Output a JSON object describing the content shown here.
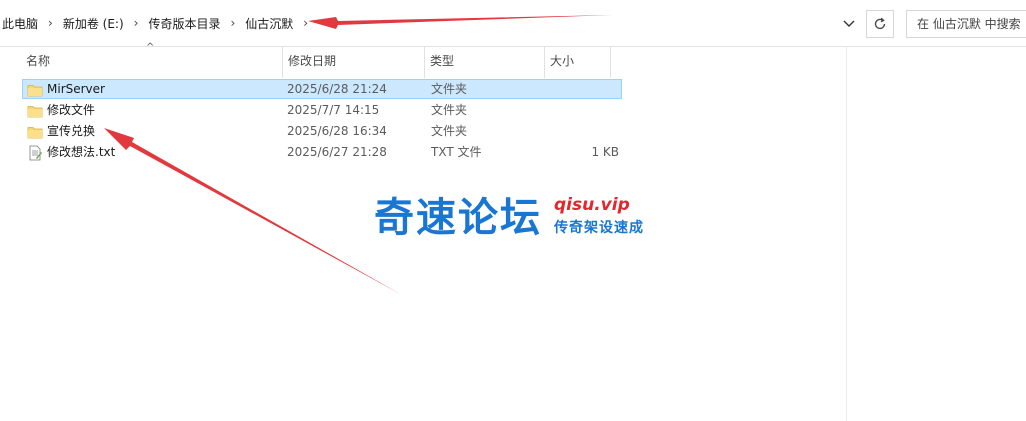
{
  "address": {
    "crumbs": [
      "此电脑",
      "新加卷 (E:)",
      "传奇版本目录",
      "仙古沉默"
    ]
  },
  "search": {
    "placeholder": "在 仙古沉默 中搜索"
  },
  "columns": {
    "name": "名称",
    "date": "修改日期",
    "type": "类型",
    "size": "大小"
  },
  "files": [
    {
      "name": "MirServer",
      "date": "2025/6/28 21:24",
      "type": "文件夹",
      "size": "",
      "icon": "folder-icon",
      "selected": true
    },
    {
      "name": "修改文件",
      "date": "2025/7/7 14:15",
      "type": "文件夹",
      "size": "",
      "icon": "folder-icon",
      "selected": false
    },
    {
      "name": "宣传兑换",
      "date": "2025/6/28 16:34",
      "type": "文件夹",
      "size": "",
      "icon": "folder-icon",
      "selected": false
    },
    {
      "name": "修改想法.txt",
      "date": "2025/6/27 21:28",
      "type": "TXT 文件",
      "size": "1 KB",
      "icon": "text-file-icon",
      "selected": false
    }
  ],
  "watermark": {
    "main": "奇速论坛",
    "domain": "qisu.vip",
    "sub": "传奇架设速成"
  },
  "colors": {
    "selection": "#cce8ff",
    "arrow": "#e0282e",
    "watermark_blue": "#1976d2"
  }
}
